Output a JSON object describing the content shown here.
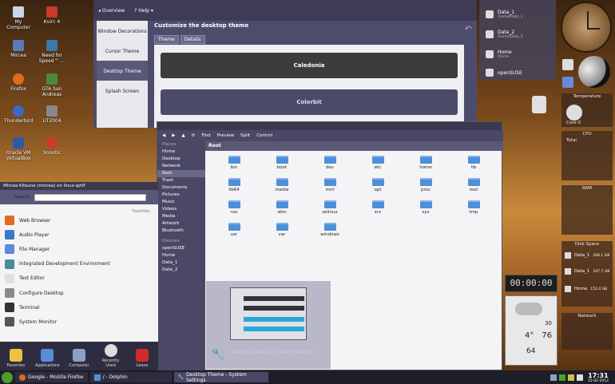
{
  "desktop_icons": [
    {
      "label": "My Computer",
      "color": "#c8d6ea"
    },
    {
      "label": "Kvirc 4",
      "color": "#c83a2a"
    },
    {
      "label": "Mircea",
      "color": "#5a7ab8"
    },
    {
      "label": "Need for Speed™ ...",
      "color": "#3a7aa8"
    },
    {
      "label": "Firefox",
      "color": "#e06a20"
    },
    {
      "label": "GTA San Andreas",
      "color": "#4a8a3a"
    },
    {
      "label": "Thunderbird",
      "color": "#3a6ac8"
    },
    {
      "label": "UT2004",
      "color": "#888888"
    },
    {
      "label": "Oracle VM VirtualBox",
      "color": "#2a5aa8"
    },
    {
      "label": "Xonotic",
      "color": "#c83a2a"
    }
  ],
  "settings": {
    "nav": [
      "Overview",
      "Help"
    ],
    "side": [
      "Window Decorations",
      "Cursor Theme",
      "Desktop Theme",
      "Splash Screen"
    ],
    "heading": "Customize the desktop theme",
    "tabs": [
      "Theme",
      "Details"
    ],
    "themes": [
      "Caledonia",
      "Colorbit"
    ]
  },
  "dolphin": {
    "toolbar": [
      "Find",
      "Preview",
      "Split",
      "Control"
    ],
    "places_header": "Places",
    "places": [
      "Home",
      "Desktop",
      "Network",
      "Root",
      "Trash",
      "Documents",
      "Pictures",
      "Music",
      "Videos",
      "Media",
      "Artwork",
      "Bluetooth"
    ],
    "devices_header": "Devices",
    "devices": [
      "openSUSE",
      "Home",
      "Data_1",
      "Data_2"
    ],
    "path": "Root",
    "folders": [
      "bin",
      "boot",
      "dev",
      "etc",
      "home",
      "lib",
      "lib64",
      "media",
      "mnt",
      "opt",
      "proc",
      "root",
      "run",
      "sbin",
      "selinux",
      "srv",
      "sys",
      "tmp",
      "usr",
      "var",
      "windows"
    ]
  },
  "preview": {
    "caption": "Desktop Theme - System Settings"
  },
  "kickoff": {
    "user": "Mircea Kitsune (mircea) on linux-qz0f",
    "search_label": "Search:",
    "favorites_label": "Favorites",
    "items": [
      "Web Browser",
      "Audio Player",
      "File Manager",
      "Integrated Development Environment",
      "Text Editor",
      "Configure Desktop",
      "Terminal",
      "System Monitor"
    ],
    "tabs": [
      "Favorites",
      "Applications",
      "Computer",
      "Recently Used",
      "Leave"
    ]
  },
  "taskbar": {
    "tasks": [
      "Google - Mozilla Firefox",
      "/ - Dolphin",
      "Desktop Theme - System Settings"
    ],
    "time": "17:31",
    "date": "15-02-2012"
  },
  "devices_widget": [
    {
      "name": "Data_1",
      "sub": "/home/Data_1"
    },
    {
      "name": "Data_2",
      "sub": "/home/Data_2"
    },
    {
      "name": "Home",
      "sub": "/home"
    },
    {
      "name": "openSUSE",
      "sub": ""
    }
  ],
  "system_widgets": {
    "temperature": "Temperature",
    "core": "Core 0",
    "cpu": "CPU",
    "total": "Total",
    "ram": "RAM",
    "disk": "Disk Space",
    "disks": [
      {
        "name": "Data_1",
        "size": "206.1 GB"
      },
      {
        "name": "Data_1",
        "size": "197.7 GB"
      },
      {
        "name": "Home",
        "size": "152.4 GB"
      }
    ],
    "network": "Network"
  },
  "weather": {
    "clock": "00:00:00",
    "hi": "30",
    "temp": "4°",
    "temp2": "76",
    "pct": "64"
  }
}
